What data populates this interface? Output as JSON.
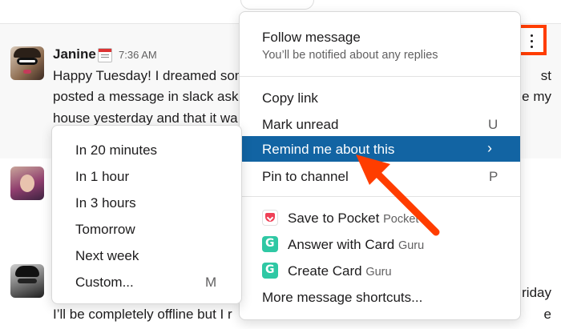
{
  "message": {
    "author": "Janine",
    "timestamp": "7:36 AM",
    "lines": [
      "Happy Tuesday! I dreamed son",
      "posted a message in slack aski",
      "house yesterday and that it wa",
      "I’ll be completely offline but I r"
    ],
    "right_fragments": [
      "st",
      "e my",
      "riday",
      "e"
    ]
  },
  "main_menu": {
    "follow_label": "Follow message",
    "follow_sub": "You’ll be notified about any replies",
    "copy_link": "Copy link",
    "mark_unread": "Mark unread",
    "mark_unread_shortcut": "U",
    "remind": "Remind me about this",
    "remind_chevron": "›",
    "pin": "Pin to channel",
    "pin_shortcut": "P",
    "apps": [
      {
        "label": "Save to Pocket",
        "source": "Pocket",
        "icon": "pocket-icon"
      },
      {
        "label": "Answer with Card",
        "source": "Guru",
        "icon": "guru-icon"
      },
      {
        "label": "Create Card",
        "source": "Guru",
        "icon": "guru-icon"
      }
    ],
    "more_shortcuts": "More message shortcuts..."
  },
  "remind_submenu": {
    "items": [
      "In 20 minutes",
      "In 1 hour",
      "In 3 hours",
      "Tomorrow",
      "Next week",
      "Custom..."
    ],
    "custom_shortcut": "M"
  },
  "colors": {
    "highlight": "#1264a3",
    "annotation": "#ff3d00"
  }
}
